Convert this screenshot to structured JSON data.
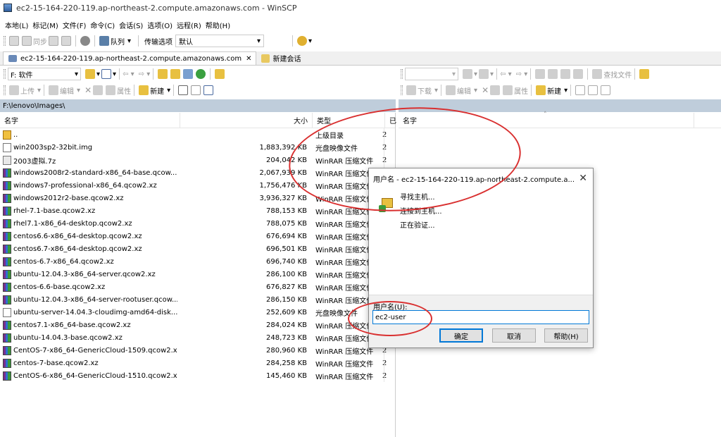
{
  "window": {
    "title": "ec2-15-164-220-119.ap-northeast-2.compute.amazonaws.com - WinSCP"
  },
  "menu": [
    "本地(L)",
    "标记(M)",
    "文件(F)",
    "命令(C)",
    "会话(S)",
    "选项(O)",
    "远程(R)",
    "帮助(H)"
  ],
  "toolbar": {
    "sync": "同步",
    "queue": "队列",
    "transfer_label": "传输选项",
    "transfer_value": "默认"
  },
  "tabs": {
    "session": "ec2-15-164-220-119.ap-northeast-2.compute.amazonaws.com",
    "new_session": "新建会话"
  },
  "local": {
    "drive": "F: 软件",
    "upload": "上传",
    "edit": "编辑",
    "properties": "属性",
    "new": "新建",
    "path": "F:\\lenovo\\Images\\",
    "columns": {
      "name": "名字",
      "size": "大小",
      "type": "类型",
      "changed": "已"
    },
    "files": [
      {
        "icon": "up",
        "name": "..",
        "size": "",
        "type": "上级目录",
        "d": "2"
      },
      {
        "icon": "img",
        "name": "win2003sp2-32bit.img",
        "size": "1,883,392 KB",
        "type": "光盘映像文件",
        "d": "2"
      },
      {
        "icon": "z7",
        "name": "2003虚拟.7z",
        "size": "204,042 KB",
        "type": "WinRAR 压缩文件",
        "d": "2"
      },
      {
        "icon": "rar",
        "name": "windows2008r2-standard-x86_64-base.qcow...",
        "size": "2,067,939 KB",
        "type": "WinRAR 压缩文件",
        "d": "2"
      },
      {
        "icon": "rar",
        "name": "windows7-professional-x86_64.qcow2.xz",
        "size": "1,756,476 KB",
        "type": "WinRAR 压缩文件",
        "d": "2"
      },
      {
        "icon": "rar",
        "name": "windows2012r2-base.qcow2.xz",
        "size": "3,936,327 KB",
        "type": "WinRAR 压缩文件",
        "d": "2"
      },
      {
        "icon": "rar",
        "name": "rhel-7.1-base.qcow2.xz",
        "size": "788,153 KB",
        "type": "WinRAR 压缩文件",
        "d": "2"
      },
      {
        "icon": "rar",
        "name": "rhel7.1-x86_64-desktop.qcow2.xz",
        "size": "788,075 KB",
        "type": "WinRAR 压缩文件",
        "d": "2"
      },
      {
        "icon": "rar",
        "name": "centos6.6-x86_64-desktop.qcow2.xz",
        "size": "676,694 KB",
        "type": "WinRAR 压缩文件",
        "d": "2"
      },
      {
        "icon": "rar",
        "name": "centos6.7-x86_64-desktop.qcow2.xz",
        "size": "696,501 KB",
        "type": "WinRAR 压缩文件",
        "d": "2"
      },
      {
        "icon": "rar",
        "name": "centos-6.7-x86_64.qcow2.xz",
        "size": "696,740 KB",
        "type": "WinRAR 压缩文件",
        "d": "2"
      },
      {
        "icon": "rar",
        "name": "ubuntu-12.04.3-x86_64-server.qcow2.xz",
        "size": "286,100 KB",
        "type": "WinRAR 压缩文件",
        "d": "2"
      },
      {
        "icon": "rar",
        "name": "centos-6.6-base.qcow2.xz",
        "size": "676,827 KB",
        "type": "WinRAR 压缩文件",
        "d": "2"
      },
      {
        "icon": "rar",
        "name": "ubuntu-12.04.3-x86_64-server-rootuser.qcow...",
        "size": "286,150 KB",
        "type": "WinRAR 压缩文件",
        "d": "2"
      },
      {
        "icon": "img",
        "name": "ubuntu-server-14.04.3-cloudimg-amd64-disk...",
        "size": "252,609 KB",
        "type": "光盘映像文件",
        "d": "2"
      },
      {
        "icon": "rar",
        "name": "centos7.1-x86_64-base.qcow2.xz",
        "size": "284,024 KB",
        "type": "WinRAR 压缩文件",
        "d": "2"
      },
      {
        "icon": "rar",
        "name": "ubuntu-14.04.3-base.qcow2.xz",
        "size": "248,723 KB",
        "type": "WinRAR 压缩文件",
        "d": "2"
      },
      {
        "icon": "rar",
        "name": "CentOS-7-x86_64-GenericCloud-1509.qcow2.xz",
        "size": "280,960 KB",
        "type": "WinRAR 压缩文件",
        "d": "2"
      },
      {
        "icon": "rar",
        "name": "centos-7-base.qcow2.xz",
        "size": "284,258 KB",
        "type": "WinRAR 压缩文件",
        "d": "2"
      },
      {
        "icon": "rar",
        "name": "CentOS-6-x86_64-GenericCloud-1510.qcow2.xz",
        "size": "145,460 KB",
        "type": "WinRAR 压缩文件",
        "d": "2"
      }
    ]
  },
  "remote": {
    "find_files": "查找文件",
    "download": "下载",
    "edit": "编辑",
    "properties": "属性",
    "new": "新建",
    "columns": {
      "name": "名字"
    }
  },
  "dialog": {
    "title": "用户名 - ec2-15-164-220-119.ap-northeast-2.compute.a...",
    "steps": [
      "寻找主机...",
      "连接到主机...",
      "正在验证..."
    ],
    "username_label": "用户名(U):",
    "username_value": "ec2-user",
    "ok": "确定",
    "cancel": "取消",
    "help": "帮助(H)"
  }
}
